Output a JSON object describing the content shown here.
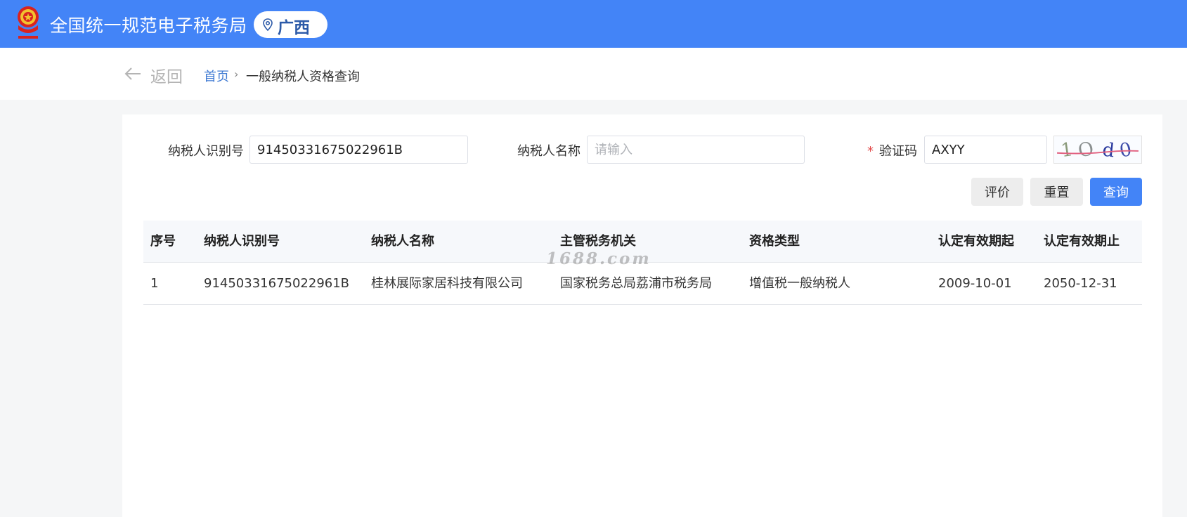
{
  "header": {
    "title": "全国统一规范电子税务局",
    "region": "广西",
    "emblem_icon": "national-emblem-icon",
    "pin_icon": "location-pin-icon",
    "color": "#4384f7"
  },
  "breadcrumb": {
    "back_label": "返回",
    "home": "首页",
    "separator": "›",
    "current": "一般纳税人资格查询"
  },
  "form": {
    "taxpayer_id": {
      "label": "纳税人识别号",
      "value": "91450331675022961B"
    },
    "taxpayer_name": {
      "label": "纳税人名称",
      "value": "",
      "placeholder": "请输入"
    },
    "captcha": {
      "required_mark": "*",
      "label": "验证码",
      "value": "AXYY",
      "image_text": "1Od0"
    }
  },
  "buttons": {
    "evaluate": "评价",
    "reset": "重置",
    "query": "查询"
  },
  "table": {
    "columns": [
      "序号",
      "纳税人识别号",
      "纳税人名称",
      "主管税务机关",
      "资格类型",
      "认定有效期起",
      "认定有效期止"
    ],
    "rows": [
      [
        "1",
        "91450331675022961B",
        "桂林展际家居科技有限公司",
        "国家税务总局荔浦市税务局",
        "增值税一般纳税人",
        "2009-10-01",
        "2050-12-31"
      ]
    ]
  },
  "watermark": "1688.com"
}
